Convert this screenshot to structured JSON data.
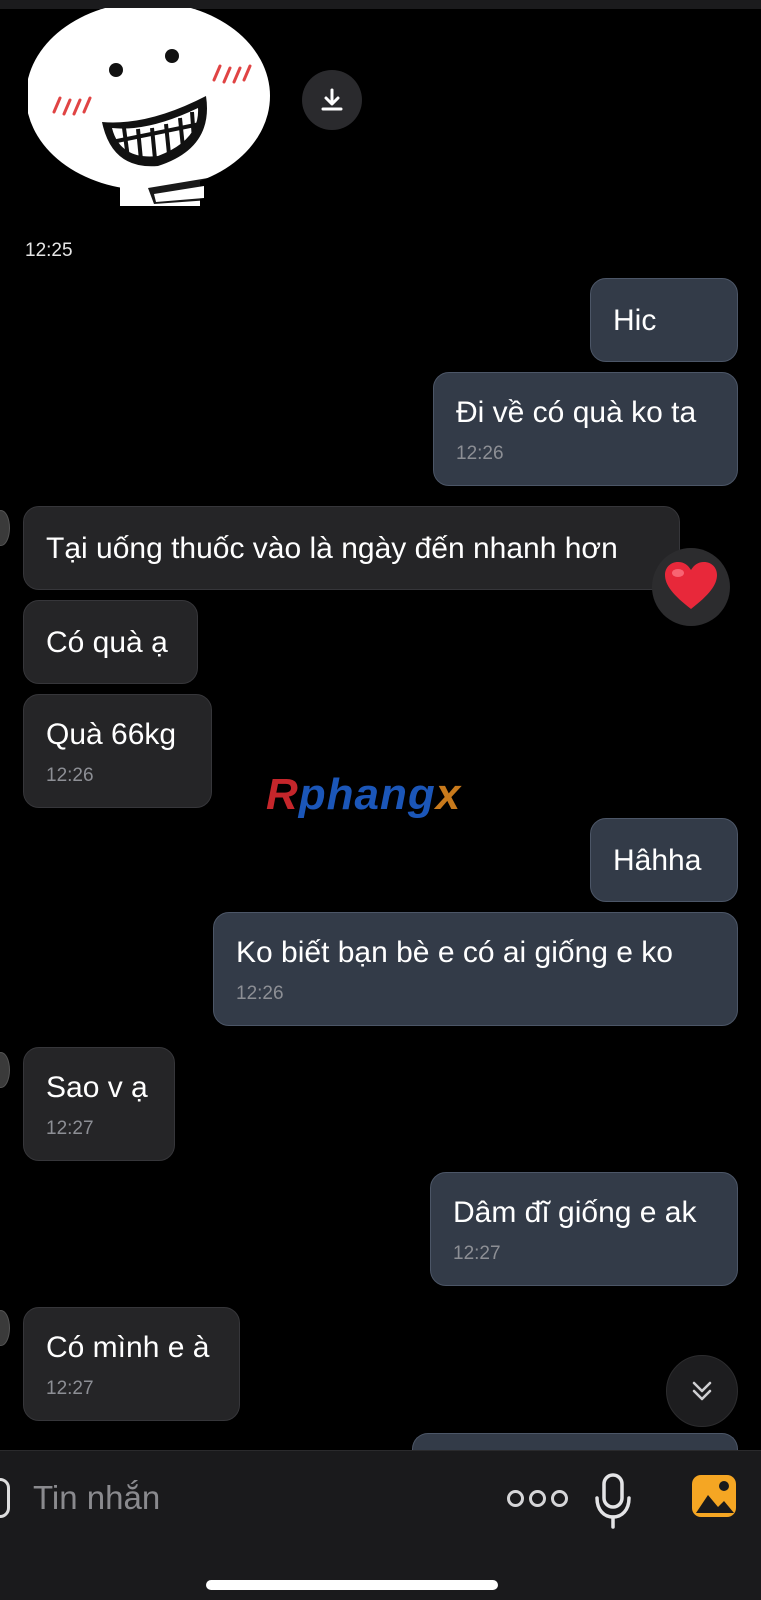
{
  "sticker": {
    "time": "12:25"
  },
  "messages": [
    {
      "id": "m1",
      "dir": "out",
      "text": "Hic",
      "time": ""
    },
    {
      "id": "m2",
      "dir": "out",
      "text": "Đi về có quà ko ta",
      "time": "12:26"
    },
    {
      "id": "m3",
      "dir": "in",
      "text": "Tại uống thuốc vào là ngày đến nhanh hơn",
      "time": "",
      "reaction": "❤️"
    },
    {
      "id": "m4",
      "dir": "in",
      "text": "Có quà ạ",
      "time": ""
    },
    {
      "id": "m5",
      "dir": "in",
      "text": "Quà 66kg",
      "time": "12:26"
    },
    {
      "id": "m6",
      "dir": "out",
      "text": "Hâhha",
      "time": ""
    },
    {
      "id": "m7",
      "dir": "out",
      "text": "Ko biết bạn bè e có ai giống e ko",
      "time": "12:26"
    },
    {
      "id": "m8",
      "dir": "in",
      "text": "Sao v ạ",
      "time": "12:27"
    },
    {
      "id": "m9",
      "dir": "out",
      "text": "Dâm đĩ giống e ak",
      "time": "12:27"
    },
    {
      "id": "m10",
      "dir": "in",
      "text": "Có mình e à",
      "time": "12:27"
    }
  ],
  "watermark": {
    "part1": "R",
    "part2": "phang",
    "part3": "",
    "part4": "x"
  },
  "composer": {
    "placeholder": "Tin nhắn"
  },
  "icons": {
    "download": "download-icon",
    "heart": "heart-reaction-icon",
    "scroll_down": "double-chevron-down-icon",
    "more": "more-options-icon",
    "mic": "microphone-icon",
    "gallery": "gallery-icon"
  },
  "colors": {
    "background": "#000000",
    "outgoing_bubble": "#333b48",
    "incoming_bubble": "#252527",
    "time_text": "#8d8f95",
    "gallery_accent": "#f5a623"
  }
}
